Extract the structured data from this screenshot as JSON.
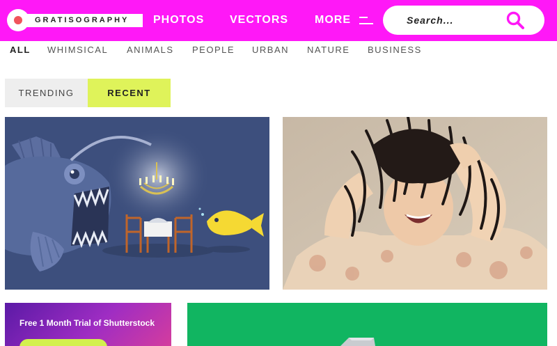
{
  "header": {
    "logo_text": "GRATISOGRAPHY",
    "nav": {
      "photos": "PHOTOS",
      "vectors": "VECTORS",
      "more": "MORE"
    },
    "search_placeholder": "Search...",
    "icons": [
      "menu-icon",
      "search-icon"
    ],
    "colors": {
      "header_bg": "#ff18f7",
      "accent": "#dff35a",
      "logo_dot": "#f0545c"
    }
  },
  "categories": [
    {
      "label": "ALL",
      "active": true
    },
    {
      "label": "WHIMSICAL",
      "active": false
    },
    {
      "label": "ANIMALS",
      "active": false
    },
    {
      "label": "PEOPLE",
      "active": false
    },
    {
      "label": "URBAN",
      "active": false
    },
    {
      "label": "NATURE",
      "active": false
    },
    {
      "label": "BUSINESS",
      "active": false
    }
  ],
  "sort_tabs": {
    "trending": "TRENDING",
    "recent": "RECENT",
    "active": "recent"
  },
  "promo": {
    "text": "Free 1 Month Trial of Shutterstock"
  }
}
